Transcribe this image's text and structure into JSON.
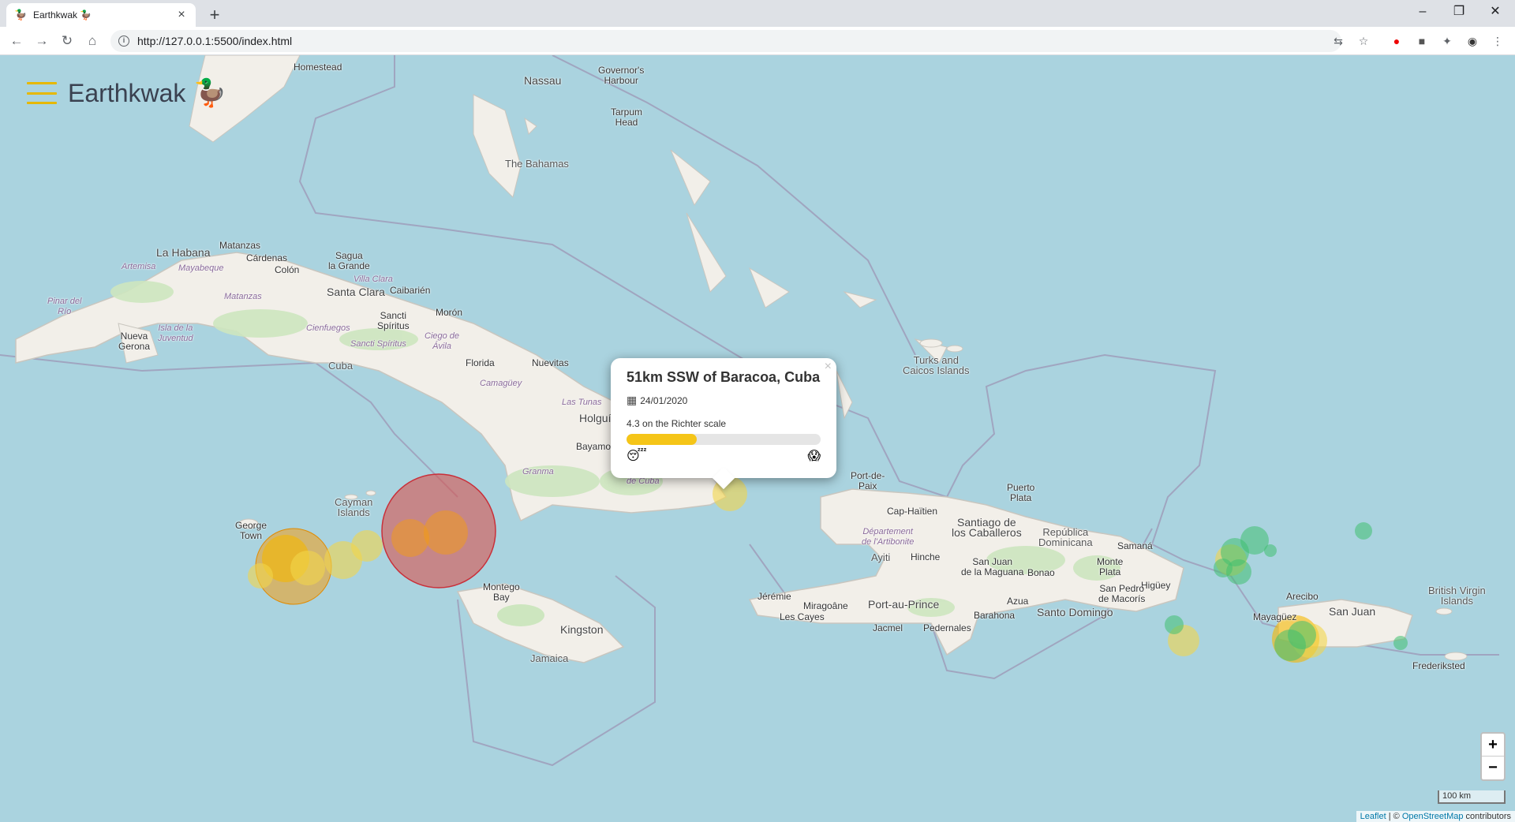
{
  "browser": {
    "tab_title": "Earthkwak 🦆",
    "tab_favicon": "🦆",
    "url_base": "http://127.0.0.1:5500/index.html"
  },
  "app": {
    "title": "Earthkwak",
    "logo": "🦆"
  },
  "popup": {
    "title": "51km SSW of Baracoa, Cuba",
    "date": "24/01/2020",
    "magnitude_text": "4.3 on the Richter scale",
    "magnitude": 4.3,
    "magnitude_fraction": 0.36,
    "low_emoji": "😴",
    "high_emoji": "😱",
    "close_label": "×"
  },
  "map": {
    "labels": [
      {
        "text": "Homestead",
        "cls": ""
      },
      {
        "text": "Nassau",
        "cls": "big"
      },
      {
        "text": "Governor's\nHarbour",
        "cls": ""
      },
      {
        "text": "Tarpum\nHead",
        "cls": ""
      },
      {
        "text": "The Bahamas",
        "cls": "country"
      },
      {
        "text": "La Habana",
        "cls": "big"
      },
      {
        "text": "Matanzas",
        "cls": ""
      },
      {
        "text": "Cárdenas",
        "cls": ""
      },
      {
        "text": "Sagua\nla Grande",
        "cls": ""
      },
      {
        "text": "Colón",
        "cls": ""
      },
      {
        "text": "Artemisa",
        "cls": "region"
      },
      {
        "text": "Mayabeque",
        "cls": "region"
      },
      {
        "text": "Villa Clara",
        "cls": "region"
      },
      {
        "text": "Santa Clara",
        "cls": "big"
      },
      {
        "text": "Caibarién",
        "cls": ""
      },
      {
        "text": "Pinar del\nRío",
        "cls": "region"
      },
      {
        "text": "Matanzas",
        "cls": "region"
      },
      {
        "text": "Morón",
        "cls": ""
      },
      {
        "text": "Sancti\nSpíritus",
        "cls": ""
      },
      {
        "text": "Isla de la\nJuventud",
        "cls": "region"
      },
      {
        "text": "Cienfuegos",
        "cls": "region"
      },
      {
        "text": "Nueva\nGerona",
        "cls": ""
      },
      {
        "text": "Sancti Spíritus",
        "cls": "region"
      },
      {
        "text": "Ciego de\nÁvila",
        "cls": "region"
      },
      {
        "text": "Cuba",
        "cls": "country"
      },
      {
        "text": "Florida",
        "cls": ""
      },
      {
        "text": "Nuevitas",
        "cls": ""
      },
      {
        "text": "Camagüey",
        "cls": "region"
      },
      {
        "text": "Las Tunas",
        "cls": "region"
      },
      {
        "text": "Holguín",
        "cls": "big"
      },
      {
        "text": "Bayamo",
        "cls": ""
      },
      {
        "text": "Granma",
        "cls": "region"
      },
      {
        "text": "de Cuba",
        "cls": "region"
      },
      {
        "text": "Turks and\nCaicos Islands",
        "cls": "country"
      },
      {
        "text": "Cayman\nIslands",
        "cls": "country"
      },
      {
        "text": "George\nTown",
        "cls": ""
      },
      {
        "text": "Montego\nBay",
        "cls": ""
      },
      {
        "text": "Kingston",
        "cls": "big"
      },
      {
        "text": "Jamaica",
        "cls": "country"
      },
      {
        "text": "Port-de-\nPaix",
        "cls": ""
      },
      {
        "text": "Cap-Haïtien",
        "cls": ""
      },
      {
        "text": "Département\nde l'Artibonite",
        "cls": "region"
      },
      {
        "text": "Ayiti",
        "cls": "country"
      },
      {
        "text": "Hinche",
        "cls": ""
      },
      {
        "text": "Santiago de\nlos Caballeros",
        "cls": "big"
      },
      {
        "text": "Puerto\nPlata",
        "cls": ""
      },
      {
        "text": "República\nDominicana",
        "cls": "country"
      },
      {
        "text": "Samaná",
        "cls": ""
      },
      {
        "text": "Jérémie",
        "cls": ""
      },
      {
        "text": "Miragoâne",
        "cls": ""
      },
      {
        "text": "Port-au-Prince",
        "cls": "big"
      },
      {
        "text": "Les Cayes",
        "cls": ""
      },
      {
        "text": "Jacmel",
        "cls": ""
      },
      {
        "text": "Pedernales",
        "cls": ""
      },
      {
        "text": "San Juan\nde la Maguana",
        "cls": ""
      },
      {
        "text": "Bonao",
        "cls": ""
      },
      {
        "text": "Monte\nPlata",
        "cls": ""
      },
      {
        "text": "Higüey",
        "cls": ""
      },
      {
        "text": "Barahona",
        "cls": ""
      },
      {
        "text": "Azua",
        "cls": ""
      },
      {
        "text": "Santo Domingo",
        "cls": "big"
      },
      {
        "text": "San Pedro\nde Macorís",
        "cls": ""
      },
      {
        "text": "Arecibo",
        "cls": ""
      },
      {
        "text": "San Juan",
        "cls": "big"
      },
      {
        "text": "Mayagüez",
        "cls": ""
      },
      {
        "text": "British Virgin\nIslands",
        "cls": "country"
      },
      {
        "text": "Frederiksted",
        "cls": ""
      }
    ],
    "zoom_in": "+",
    "zoom_out": "−",
    "scale_label": "100 km",
    "attribution_leaflet": "Leaflet",
    "attribution_sep": " | © ",
    "attribution_osm": "OpenStreetMap",
    "attribution_tail": " contributors",
    "colors": {
      "water": "#aad3df",
      "land": "#f2efe9",
      "quake_low": "#3fbf6f",
      "quake_mid": "#f2d64b",
      "quake_high": "#f39c12",
      "quake_max": "#d9534f"
    },
    "quakes": [
      {
        "magnitude_class": "max"
      },
      {
        "magnitude_class": "high"
      },
      {
        "magnitude_class": "mid"
      },
      {
        "magnitude_class": "low"
      }
    ]
  }
}
